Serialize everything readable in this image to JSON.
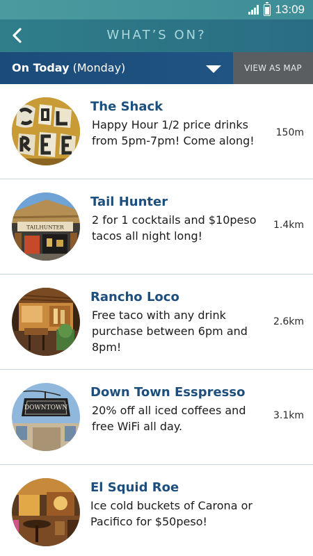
{
  "status_bar": {
    "time": "13:09",
    "icons": [
      "signal-icon",
      "battery-icon"
    ]
  },
  "header": {
    "title": "WHAT’S ON?",
    "back_icon": "chevron-left-icon"
  },
  "filter": {
    "day_label": "On Today",
    "day_value": "(Monday)",
    "dropdown_icon": "triangle-down-icon",
    "map_button": "VIEW AS MAP"
  },
  "colors": {
    "status_bar": "#4a9b9f",
    "app_bar": "#2f7e8a",
    "filter_bar": "#1b4b79",
    "map_button": "#5b5e60",
    "venue_name": "#1d4f7e",
    "divider": "#c8d8de"
  },
  "venues": [
    {
      "name": "The Shack",
      "description": "Happy Hour 1/2 price drinks from 5pm-7pm! Come along!",
      "distance": "150m"
    },
    {
      "name": "Tail Hunter",
      "description": "2 for 1 cocktails and $10peso tacos all night long!",
      "distance": "1.4km",
      "sign_text": "TAILHUNTER"
    },
    {
      "name": "Rancho Loco",
      "description": "Free taco with any drink purchase between 6pm and 8pm!",
      "distance": "2.6km"
    },
    {
      "name": "Down Town Esspresso",
      "description": "20% off all iced coffees and free WiFi all day.",
      "distance": "3.1km",
      "sign_text": "DOWNTOWN"
    },
    {
      "name": "El Squid Roe",
      "description": "Ice cold buckets of Carona or Pacifico for $50peso!",
      "distance": ""
    }
  ]
}
